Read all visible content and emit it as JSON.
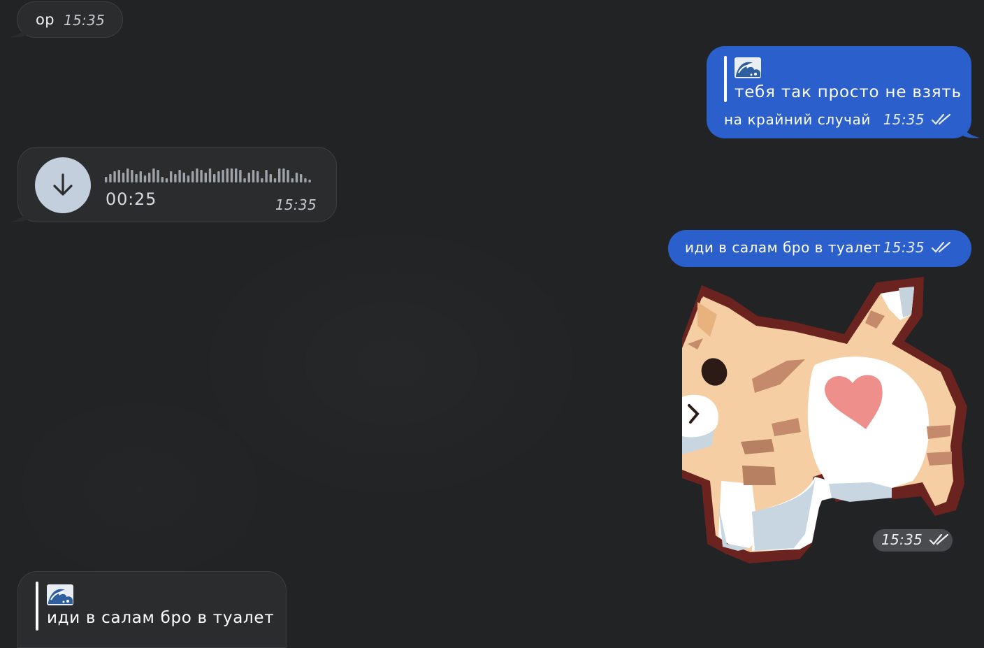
{
  "messages": {
    "m1": {
      "text": "ор",
      "time": "15:35"
    },
    "m2": {
      "quote_emoji": "🌊",
      "quote_text": "тебя так просто не взять",
      "text": "на крайний случай",
      "time": "15:35"
    },
    "m3": {
      "duration": "00:25",
      "time": "15:35"
    },
    "m4": {
      "text": "иди в салам бро в туалет",
      "time": "15:35"
    },
    "sticker": {
      "icon": "cat-heart-sticker",
      "time": "15:35"
    },
    "m6": {
      "quote_emoji": "🌊",
      "quote_text": "иди в салам бро в туалет"
    }
  },
  "colors": {
    "background": "#212325",
    "incoming_bubble": "#2b2c2e",
    "outgoing_bubble": "#2b5fcb",
    "download_button": "#c3cfdd"
  }
}
